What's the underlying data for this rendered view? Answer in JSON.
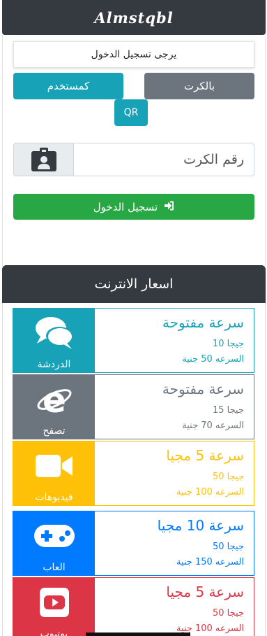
{
  "app": {
    "title": "Almstqbl"
  },
  "login": {
    "notice": "يرجى تسجيل الدخول",
    "by_card_label": "بالكرت",
    "as_user_label": "كمستخدم",
    "qr_label": "QR",
    "card_placeholder": "رقم الكرت",
    "card_value": "",
    "submit_label": "تسجيل الدخول"
  },
  "prices": {
    "title": "اسعار الانترنت",
    "items": [
      {
        "tile_label": "الدردشة",
        "icon": "chat-icon",
        "speed": "سرعة مفتوحة",
        "gb": "جيجا 10",
        "price": "السرعه 50 جنية",
        "color": "#17a2b8"
      },
      {
        "tile_label": "تصفح",
        "icon": "browser-icon",
        "speed": "سرعة مفتوحة",
        "gb": "جيجا 15",
        "price": "السرعه 70 جنية",
        "color": "#6c757d"
      },
      {
        "tile_label": "فيديوهات",
        "icon": "video-camera-icon",
        "speed": "سرعة 5 مجيا",
        "gb": "جيجا 50",
        "price": "السرعه 100 جنية",
        "color": "#ffc107"
      },
      {
        "tile_label": "العاب",
        "icon": "gamepad-icon",
        "speed": "سرعة 10 مجيا",
        "gb": "جيجا 50",
        "price": "السرعه 150 جنية",
        "color": "#007bff"
      },
      {
        "tile_label": "يوتيوب",
        "icon": "youtube-icon",
        "speed": "سرعة 5 مجيا",
        "gb": "جيجا 50",
        "price": "السرعه 100 جنية",
        "color": "#dc3545"
      }
    ]
  }
}
